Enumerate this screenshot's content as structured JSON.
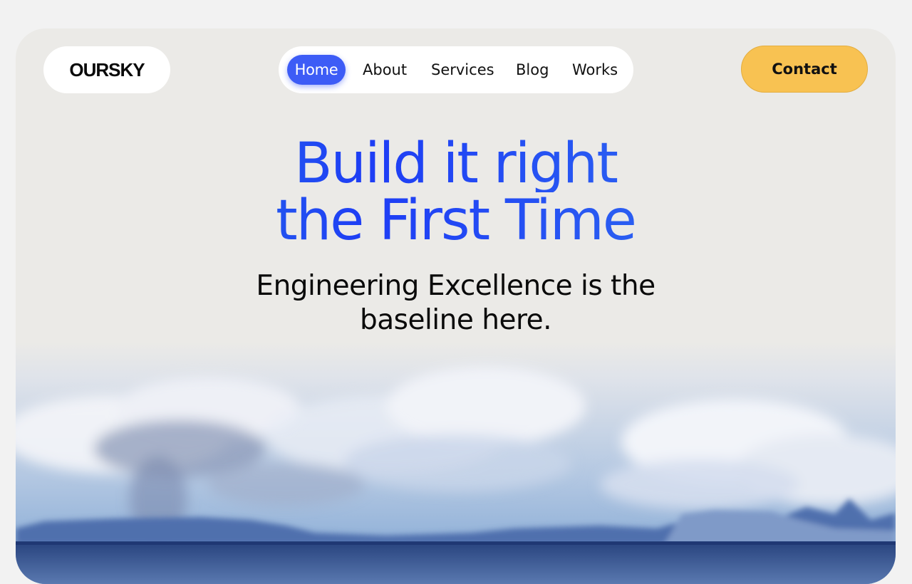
{
  "header": {
    "logo_text": "OURSKY",
    "nav": [
      {
        "label": "Home",
        "active": true
      },
      {
        "label": "About"
      },
      {
        "label": "Services"
      },
      {
        "label": "Blog"
      },
      {
        "label": "Works"
      }
    ],
    "contact_label": "Contact"
  },
  "hero": {
    "title_line1": "Build it right",
    "title_line2": "the First Time",
    "subtitle_line1": "Engineering Excellence is the",
    "subtitle_line2": "baseline here.",
    "image": "sky-clouds-mesa-lake-landscape"
  },
  "colors": {
    "page_background": "#f2f2f2",
    "card_background": "#ebeae7",
    "nav_active": "#3d5cf6",
    "contact_button": "#f8c252",
    "headline_gradient": [
      "#2f8fe2",
      "#1e3df5",
      "#0ea0f0"
    ]
  }
}
